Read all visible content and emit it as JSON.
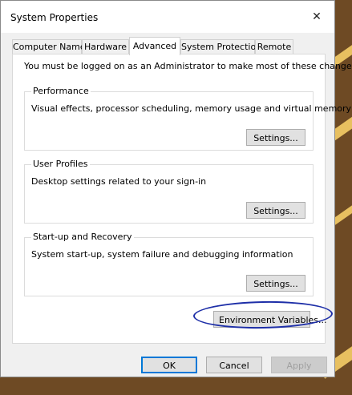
{
  "window": {
    "title": "System Properties",
    "close_glyph": "✕"
  },
  "tabs": [
    {
      "label": "Computer Name",
      "active": false
    },
    {
      "label": "Hardware",
      "active": false
    },
    {
      "label": "Advanced",
      "active": true
    },
    {
      "label": "System Protection",
      "active": false
    },
    {
      "label": "Remote",
      "active": false
    }
  ],
  "notice": "You must be logged on as an Administrator to make most of these changes.",
  "groups": {
    "performance": {
      "title": "Performance",
      "description": "Visual effects, processor scheduling, memory usage and virtual memory",
      "button": "Settings..."
    },
    "user_profiles": {
      "title": "User Profiles",
      "description": "Desktop settings related to your sign-in",
      "button": "Settings..."
    },
    "startup_recovery": {
      "title": "Start-up and Recovery",
      "description": "System start-up, system failure and debugging information",
      "button": "Settings..."
    }
  },
  "environment_button": "Environment Variables...",
  "footer": {
    "ok": "OK",
    "cancel": "Cancel",
    "apply": "Apply",
    "apply_enabled": false
  },
  "colors": {
    "accent": "#0078d7",
    "annotation": "#1e2fa8"
  }
}
